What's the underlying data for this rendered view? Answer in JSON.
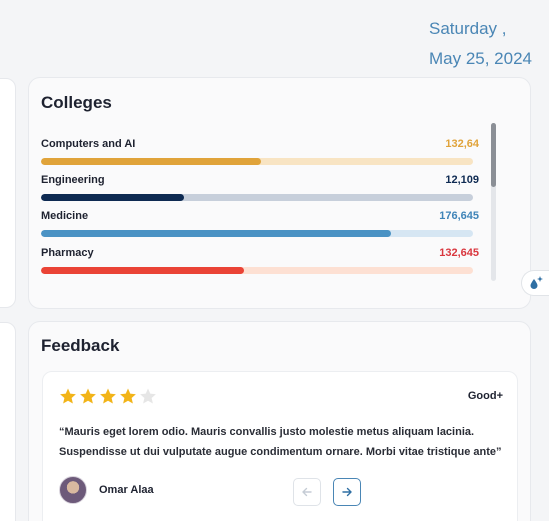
{
  "date": {
    "line1": "Saturday ,",
    "line2": "May 25, 2024"
  },
  "colleges": {
    "title": "Colleges",
    "items": [
      {
        "name": "Computers and AI",
        "value": "132,64",
        "progress": 0.51,
        "color": "#e0a33a",
        "track": "#f8e4c3"
      },
      {
        "name": "Engineering",
        "value": "12,109",
        "progress": 0.33,
        "color": "#0e2a52",
        "track": "#c7cfdb"
      },
      {
        "name": "Medicine",
        "value": "176,645",
        "progress": 0.81,
        "color": "#4a92c4",
        "track": "#d6e6f3"
      },
      {
        "name": "Pharmacy",
        "value": "132,645",
        "progress": 0.47,
        "color": "#ea4336",
        "track": "#fde0d3"
      }
    ],
    "value_colors": [
      "#e0a33a",
      "#0e2a52",
      "#3f84b8",
      "#d9363e"
    ]
  },
  "feedback": {
    "title": "Feedback",
    "rating_stars": 4,
    "rating_max": 5,
    "rating_label": "Good+",
    "quote": "“Mauris eget lorem odio. Mauris convallis justo molestie metus aliquam lacinia. Suspendisse ut dui vulputate augue condimentum ornare. Morbi vitae tristique ante”",
    "author": "Omar Alaa"
  },
  "icons": {
    "prev": "arrow-left-icon",
    "next": "arrow-right-icon",
    "fab": "water-drop-sparkle-icon"
  },
  "colors": {
    "accent": "#4a86b5",
    "star": "#f2b418",
    "star_empty": "#e6e6e6"
  }
}
